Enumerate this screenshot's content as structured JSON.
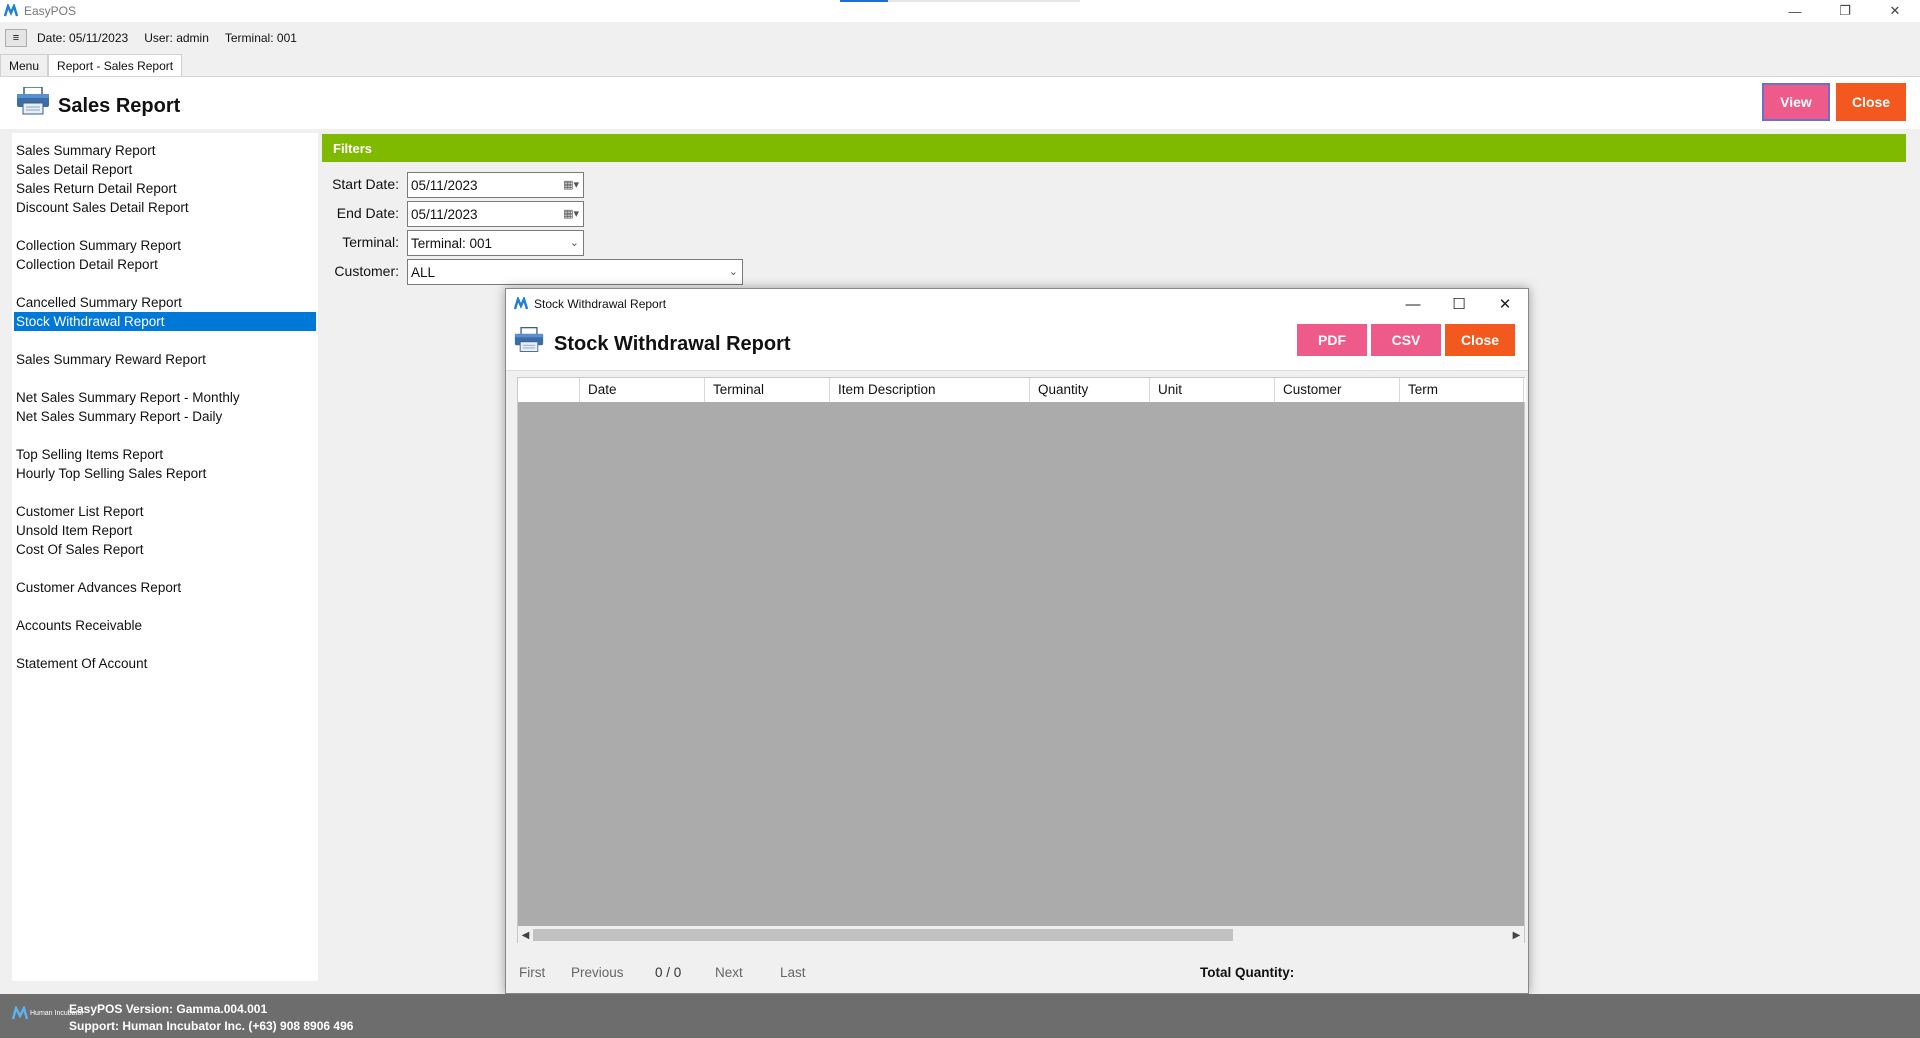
{
  "window": {
    "title": "EasyPOS",
    "controls": {
      "minimize": "—",
      "restore": "❐",
      "close": "✕"
    }
  },
  "infobar": {
    "menu_glyph": "≡",
    "date": "Date: 05/11/2023",
    "user": "User: admin",
    "terminal": "Terminal: 001"
  },
  "tabs": [
    {
      "label": "Menu",
      "active": false
    },
    {
      "label": "Report - Sales Report",
      "active": true
    }
  ],
  "header": {
    "title": "Sales Report",
    "view_label": "View",
    "close_label": "Close",
    "colors": {
      "view": "#ee5a8a",
      "close": "#f3581f"
    }
  },
  "sidebar": {
    "items": [
      {
        "label": "Sales Summary Report",
        "selected": false
      },
      {
        "label": "Sales Detail Report",
        "selected": false
      },
      {
        "label": "Sales Return Detail Report",
        "selected": false
      },
      {
        "label": "Discount Sales Detail Report",
        "selected": false
      },
      {
        "label": "Collection Summary Report",
        "selected": false
      },
      {
        "label": "Collection Detail Report",
        "selected": false
      },
      {
        "label": "Cancelled Summary Report",
        "selected": false
      },
      {
        "label": "Stock Withdrawal Report",
        "selected": true
      },
      {
        "label": "Sales Summary Reward Report",
        "selected": false
      },
      {
        "label": "Net Sales Summary Report - Monthly",
        "selected": false
      },
      {
        "label": "Net Sales Summary Report - Daily",
        "selected": false
      },
      {
        "label": "Top Selling Items Report",
        "selected": false
      },
      {
        "label": "Hourly Top Selling Sales Report",
        "selected": false
      },
      {
        "label": "Customer List Report",
        "selected": false
      },
      {
        "label": "Unsold Item Report",
        "selected": false
      },
      {
        "label": "Cost Of Sales Report",
        "selected": false
      },
      {
        "label": "Customer Advances Report",
        "selected": false
      },
      {
        "label": "Accounts Receivable",
        "selected": false
      },
      {
        "label": "Statement Of Account",
        "selected": false
      }
    ]
  },
  "filters": {
    "title": "Filters",
    "start_date_label": "Start Date:",
    "start_date_value": "05/11/2023",
    "end_date_label": "End Date:",
    "end_date_value": "05/11/2023",
    "terminal_label": "Terminal:",
    "terminal_value": "Terminal: 001",
    "customer_label": "Customer:",
    "customer_value": "ALL",
    "accent_color": "#7fba00"
  },
  "dialog": {
    "window_title": "Stock Withdrawal Report",
    "title": "Stock Withdrawal Report",
    "pdf_label": "PDF",
    "csv_label": "CSV",
    "close_label": "Close",
    "controls": {
      "minimize": "—",
      "maximize": "☐",
      "close": "✕"
    },
    "columns": [
      "",
      "Date",
      "Terminal",
      "Item Description",
      "Quantity",
      "Unit",
      "Customer",
      "Term"
    ],
    "rows": [],
    "nav": {
      "first": "First",
      "previous": "Previous",
      "page": "0 / 0",
      "next": "Next",
      "last": "Last",
      "total_quantity_label": "Total Quantity:"
    }
  },
  "statusbar": {
    "logo_text": "Human Incubator",
    "version": "EasyPOS Version: Gamma.004.001",
    "support": "Support: Human Incubator Inc. (+63) 908 8906 496"
  }
}
